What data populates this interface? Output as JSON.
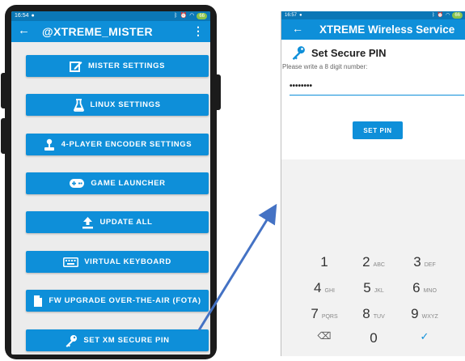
{
  "left_phone": {
    "status": {
      "time": "16:54",
      "battery": "66"
    },
    "app_bar": {
      "title": "@XTREME_MISTER"
    },
    "menu": [
      {
        "label": "MISTER SETTINGS",
        "icon": "edit-icon"
      },
      {
        "label": "LINUX SETTINGS",
        "icon": "flask-icon"
      },
      {
        "label": "4-PLAYER ENCODER SETTINGS",
        "icon": "joystick-icon"
      },
      {
        "label": "GAME LAUNCHER",
        "icon": "gamepad-icon"
      },
      {
        "label": "UPDATE ALL",
        "icon": "upload-icon"
      },
      {
        "label": "VIRTUAL KEYBOARD",
        "icon": "keyboard-icon"
      },
      {
        "label": "FW UPGRADE OVER-THE-AIR (FOTA)",
        "icon": "file-icon"
      },
      {
        "label": "SET XM SECURE PIN",
        "icon": "key-icon"
      }
    ]
  },
  "right_phone": {
    "status": {
      "time": "16:57",
      "battery": "66"
    },
    "app_bar": {
      "title": "XTREME Wireless Service"
    },
    "pin": {
      "title": "Set Secure PIN",
      "subtitle": "Please write a 8 digit number:",
      "value": "••••••••",
      "button": "SET PIN"
    },
    "keypad": [
      {
        "num": "1",
        "letters": ""
      },
      {
        "num": "2",
        "letters": "ABC"
      },
      {
        "num": "3",
        "letters": "DEF"
      },
      {
        "num": "4",
        "letters": "GHI"
      },
      {
        "num": "5",
        "letters": "JKL"
      },
      {
        "num": "6",
        "letters": "MNO"
      },
      {
        "num": "7",
        "letters": "PQRS"
      },
      {
        "num": "8",
        "letters": "TUV"
      },
      {
        "num": "9",
        "letters": "WXYZ"
      },
      {
        "num": "⌫",
        "letters": ""
      },
      {
        "num": "0",
        "letters": ""
      },
      {
        "num": "✓",
        "letters": ""
      }
    ]
  },
  "colors": {
    "accent": "#0e8fd9",
    "status_bar": "#0b77b6",
    "arrow": "#4472c4"
  }
}
